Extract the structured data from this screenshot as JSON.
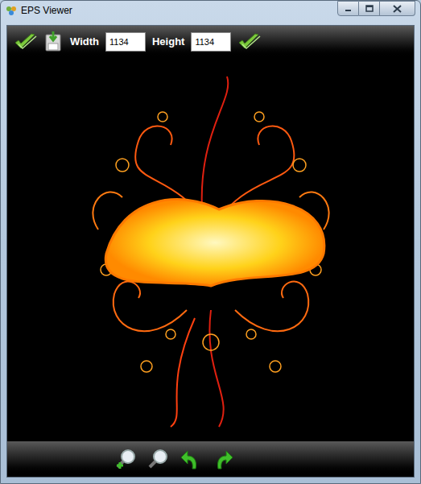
{
  "window": {
    "title": "EPS Viewer"
  },
  "toolbar": {
    "width_label": "Width",
    "width_value": "1134",
    "height_label": "Height",
    "height_value": "1134"
  }
}
